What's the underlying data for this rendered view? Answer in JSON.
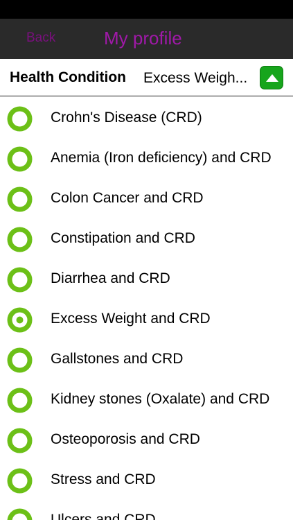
{
  "nav": {
    "back_label": "Back",
    "title": "My profile"
  },
  "selector": {
    "label": "Health Condition",
    "value": "Excess Weigh...",
    "toggle_icon": "triangle-up-icon"
  },
  "conditions": [
    {
      "label": "Crohn's Disease (CRD)",
      "selected": false
    },
    {
      "label": "Anemia (Iron deficiency) and CRD",
      "selected": false
    },
    {
      "label": "Colon Cancer and CRD",
      "selected": false
    },
    {
      "label": "Constipation and CRD",
      "selected": false
    },
    {
      "label": "Diarrhea and CRD",
      "selected": false
    },
    {
      "label": "Excess Weight and CRD",
      "selected": true
    },
    {
      "label": "Gallstones and CRD",
      "selected": false
    },
    {
      "label": "Kidney stones (Oxalate) and CRD",
      "selected": false
    },
    {
      "label": "Osteoporosis and CRD",
      "selected": false
    },
    {
      "label": "Stress and CRD",
      "selected": false
    },
    {
      "label": "Ulcers and CRD",
      "selected": false
    }
  ],
  "colors": {
    "accent_purple": "#a019a8",
    "radio_green": "#6cc017",
    "toggle_green": "#17a51c"
  }
}
